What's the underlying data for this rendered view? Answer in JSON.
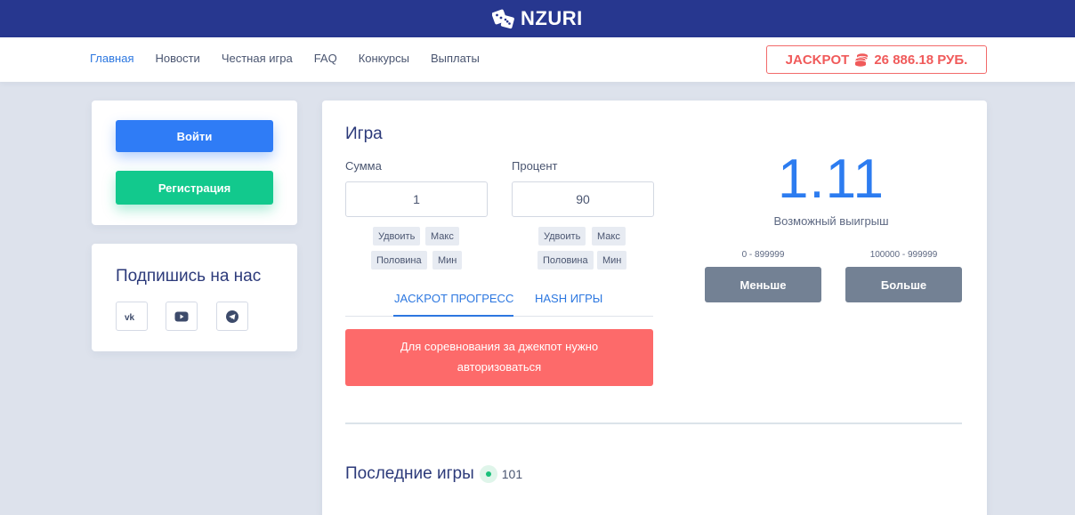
{
  "brand": {
    "name": "NZURI",
    "logo_icon": "dice-icon"
  },
  "nav": {
    "items": [
      {
        "label": "Главная",
        "active": true
      },
      {
        "label": "Новости"
      },
      {
        "label": "Честная игра"
      },
      {
        "label": "FAQ"
      },
      {
        "label": "Конкурсы"
      },
      {
        "label": "Выплаты"
      }
    ],
    "jackpot": {
      "label": "JACKPOT",
      "amount": "26 886.18 РУБ.",
      "icon": "coins-icon",
      "color": "#f05a5a"
    }
  },
  "auth": {
    "login_label": "Войти",
    "register_label": "Регистрация"
  },
  "social": {
    "title": "Подпишись на нас",
    "buttons": [
      {
        "icon": "vk-icon"
      },
      {
        "icon": "youtube-icon"
      },
      {
        "icon": "telegram-icon"
      }
    ]
  },
  "game": {
    "title": "Игра",
    "amount": {
      "label": "Сумма",
      "value": "1",
      "chips": [
        "Удвоить",
        "Макс",
        "Половина",
        "Мин"
      ]
    },
    "percent": {
      "label": "Процент",
      "value": "90",
      "chips": [
        "Удвоить",
        "Макс",
        "Половина",
        "Мин"
      ]
    },
    "tabs": [
      {
        "label": "JACKPOT ПРОГРЕСС",
        "active": true
      },
      {
        "label": "HASH ИГРЫ"
      }
    ],
    "alert_line1": "Для соревнования за джекпот нужно",
    "alert_line2": "авторизоваться",
    "payout": "1.11",
    "payout_label": "Возможный выигрыш",
    "lower": {
      "range": "0 - 899999",
      "label": "Меньше"
    },
    "higher": {
      "range": "100000 - 999999",
      "label": "Больше"
    }
  },
  "last_games": {
    "title": "Последние игры",
    "online": "101"
  },
  "colors": {
    "header": "#27378f",
    "accent": "#2c77e0",
    "login": "#2f7cf6",
    "register": "#12c98d",
    "alert": "#fd6a6a",
    "bet_button": "#738194"
  }
}
